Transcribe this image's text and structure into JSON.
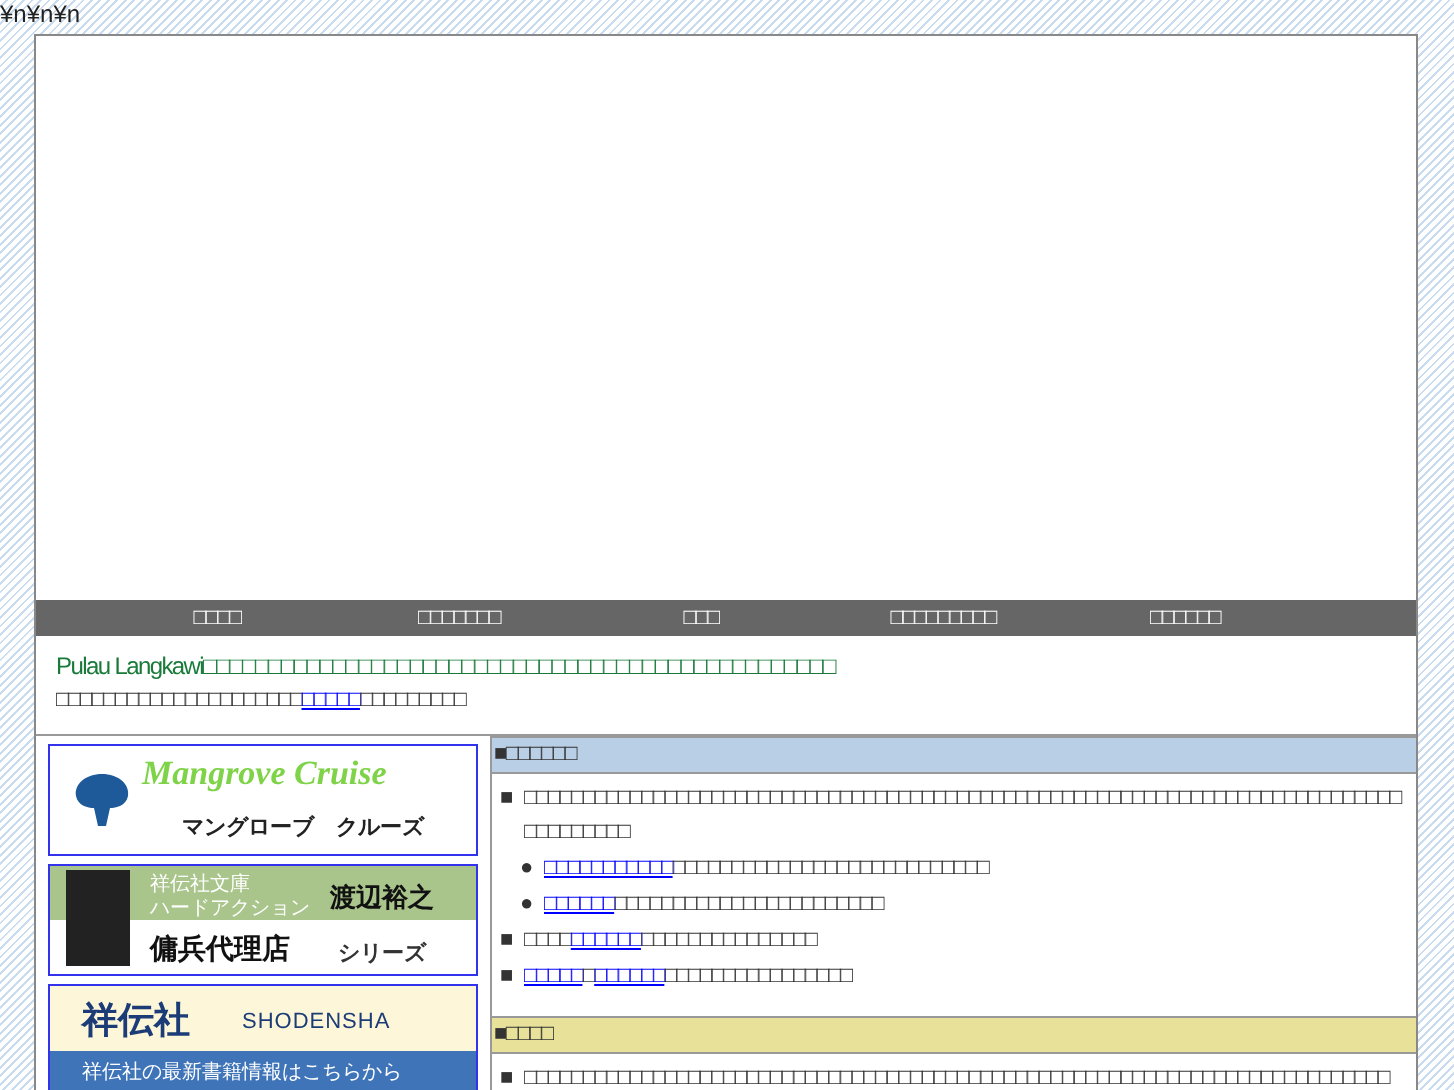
{
  "top_text": "¥n¥n¥n",
  "nav": [
    {
      "label": "□□□□"
    },
    {
      "label": "□□□□□□□"
    },
    {
      "label": "□□□"
    },
    {
      "label": "□□□□□□□□□"
    },
    {
      "label": "□□□□□□"
    }
  ],
  "intro": {
    "lead": "Pulau Langkawi□□□□□□□□□□□□□□□□□□□□□□□□□□□□□□□□□□□□□□□□□□□□□□□□□",
    "line2": [
      {
        "kind": "text",
        "text": "□□□□□□□□□□□□□□□□□□□□□"
      },
      {
        "kind": "link",
        "text": "□□□□□"
      },
      {
        "kind": "text",
        "text": "□□□□□□□□□"
      }
    ]
  },
  "banners": [
    {
      "kind": "mangrove",
      "title": "Mangrove Cruise",
      "subtitle": "マングローブ　クルーズ"
    },
    {
      "kind": "book",
      "label": "祥伝社文庫",
      "genre": "ハードアクション",
      "author": "渡辺裕之",
      "series": "傭兵代理店",
      "suffix": "シリーズ"
    },
    {
      "kind": "publisher",
      "name": "祥伝社",
      "roman": "SHODENSHA",
      "note": "祥伝社の最新書籍情報はこちらから"
    }
  ],
  "sections": [
    {
      "title": "■□□□□□□",
      "color": "#b9cfe6",
      "items": [
        {
          "marker": "■",
          "segments": [
            {
              "kind": "text",
              "text": "□□□□□□□□□□□□□□□□□□□□□□□□□□□□□□□□□□□□□□□□□□□□□□□□□□□□□□□□□□□□□□□□□□□□□□□□□□□□□□□□□□□□"
            }
          ],
          "children": [
            {
              "marker": "●",
              "segments": [
                {
                  "kind": "link",
                  "text": "□□□□□□□□□□□"
                },
                {
                  "kind": "text",
                  "text": "□□□□□□□□□□□□□□□□□□□□□□□□□□□"
                }
              ]
            },
            {
              "marker": "●",
              "segments": [
                {
                  "kind": "link",
                  "text": "□□□□□□"
                },
                {
                  "kind": "text",
                  "text": "□□□□□□□□□□□□□□□□□□□□□□□"
                }
              ]
            }
          ]
        },
        {
          "marker": "■",
          "segments": [
            {
              "kind": "text",
              "text": "□□□□"
            },
            {
              "kind": "link",
              "text": "□□□□□□"
            },
            {
              "kind": "text",
              "text": "□□□□□□□□□□□□□□□"
            }
          ]
        },
        {
          "marker": "■",
          "segments": [
            {
              "kind": "link",
              "text": "□□□□□"
            },
            {
              "kind": "text",
              "text": "□"
            },
            {
              "kind": "link",
              "text": "□□□□□□"
            },
            {
              "kind": "text",
              "text": "□□□□□□□□□□□□□□□□"
            }
          ]
        }
      ]
    },
    {
      "title": "■□□□□",
      "color": "#e8e19a",
      "items": [
        {
          "marker": "■",
          "segments": [
            {
              "kind": "text",
              "text": "□□□□□□□□□□□□□□□□□□□□□□□□□□□□□□□□□□□□□□□□□□□□□□□□□□□□□□□□□□□□□□□□□□□□□□□□□□"
            }
          ]
        }
      ]
    }
  ]
}
